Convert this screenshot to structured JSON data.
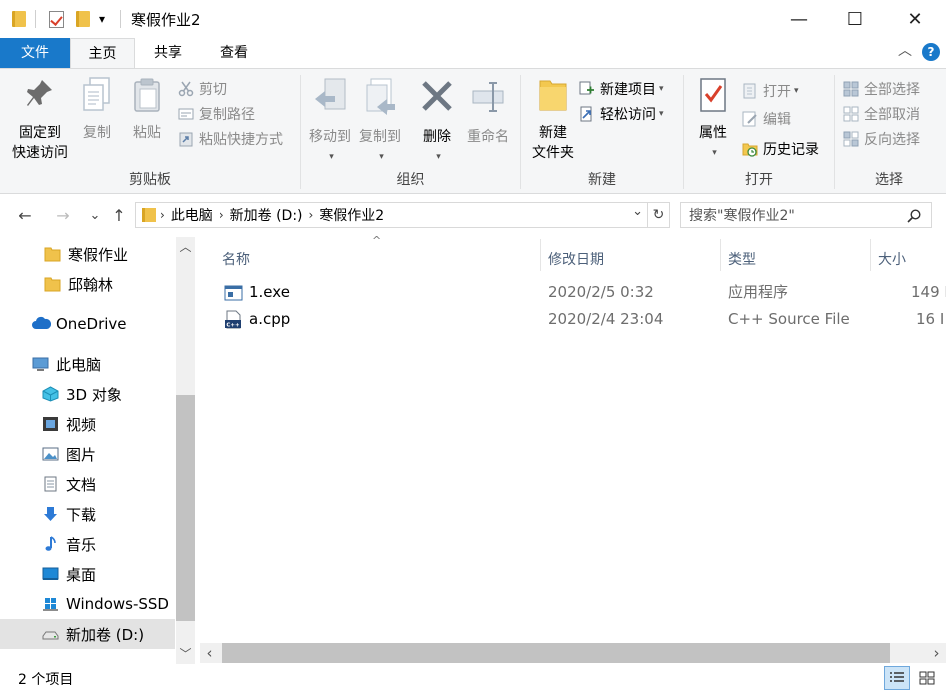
{
  "window": {
    "title": "寒假作业2",
    "qa_dropdown_glyph": "▾",
    "minimize_glyph": "—",
    "maximize_glyph": "☐",
    "close_glyph": "✕"
  },
  "ribbon_tabs": [
    "文件",
    "主页",
    "共享",
    "查看"
  ],
  "ribbon_controls": {
    "collapse": "︿",
    "help": "?"
  },
  "ribbon": {
    "clipboard": {
      "label": "剪贴板",
      "pin_line1": "固定到",
      "pin_line2": "快速访问",
      "copy": "复制",
      "paste": "粘贴",
      "cut": "剪切",
      "copy_path": "复制路径",
      "paste_shortcut": "粘贴快捷方式"
    },
    "organize": {
      "label": "组织",
      "move_to": "移动到",
      "copy_to": "复制到",
      "delete": "删除",
      "rename": "重命名"
    },
    "new": {
      "label": "新建",
      "new_folder_line1": "新建",
      "new_folder_line2": "文件夹",
      "new_item": "新建项目",
      "easy_access": "轻松访问"
    },
    "open": {
      "label": "打开",
      "properties": "属性",
      "open": "打开",
      "edit": "编辑",
      "history": "历史记录"
    },
    "select": {
      "label": "选择",
      "select_all": "全部选择",
      "select_none": "全部取消",
      "invert": "反向选择"
    }
  },
  "nav": {
    "back": "←",
    "forward": "→",
    "recent": "⌄",
    "up": "↑",
    "dropdown": "⌄",
    "refresh": "↻"
  },
  "breadcrumb": [
    "此电脑",
    "新加卷 (D:)",
    "寒假作业2"
  ],
  "breadcrumb_sep": "›",
  "search_placeholder": "搜索\"寒假作业2\"",
  "sidebar": [
    {
      "label": "寒假作业",
      "icon": "folder-icon"
    },
    {
      "label": "邱翰林",
      "icon": "folder-icon"
    },
    {
      "label": "OneDrive",
      "icon": "onedrive-icon"
    },
    {
      "label": "此电脑",
      "icon": "computer-icon"
    },
    {
      "label": "3D 对象",
      "icon": "cube-icon"
    },
    {
      "label": "视频",
      "icon": "video-icon"
    },
    {
      "label": "图片",
      "icon": "picture-icon"
    },
    {
      "label": "文档",
      "icon": "document-icon"
    },
    {
      "label": "下载",
      "icon": "download-icon"
    },
    {
      "label": "音乐",
      "icon": "music-icon"
    },
    {
      "label": "桌面",
      "icon": "desktop-icon"
    },
    {
      "label": "Windows-SSD (",
      "icon": "windows-drive-icon"
    },
    {
      "label": "新加卷 (D:)",
      "icon": "drive-icon"
    }
  ],
  "scroll_glyphs": {
    "up": "︿",
    "down": "﹀",
    "left": "‹",
    "right": "›",
    "sort": "^"
  },
  "columns": [
    "名称",
    "修改日期",
    "类型",
    "大小"
  ],
  "files": [
    {
      "name": "1.exe",
      "date": "2020/2/5 0:32",
      "type": "应用程序",
      "size": "149 I"
    },
    {
      "name": "a.cpp",
      "date": "2020/2/4 23:04",
      "type": "C++ Source File",
      "size": "16 I"
    }
  ],
  "status": {
    "count": "2 个项目"
  },
  "colors": {
    "accent": "#1979ca",
    "folder": "#f0c24b",
    "onedrive": "#1e6fc8"
  }
}
